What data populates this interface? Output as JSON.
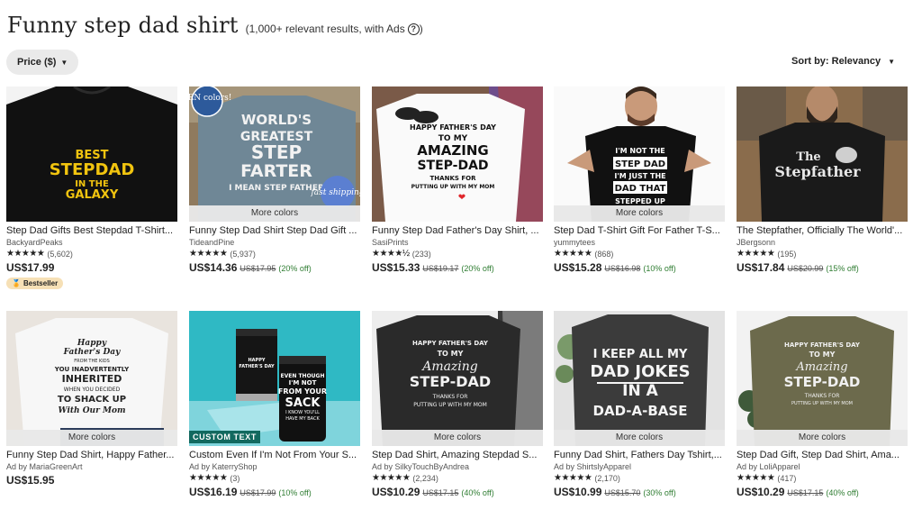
{
  "search": {
    "title": "Funny step dad shirt",
    "results_text": "(1,000+ relevant results, with Ads",
    "help_icon": "?",
    "close_paren": ")"
  },
  "filters": {
    "price_label": "Price ($)",
    "sort_label": "Sort by: Relevancy"
  },
  "products": [
    {
      "title": "Step Dad Gifts Best Stepdad T-Shirt...",
      "shop": "BackyardPeaks",
      "stars": "★★★★★",
      "reviews": "(5,602)",
      "price": "US$17.99",
      "original": "",
      "discount": "",
      "badge": "Bestseller",
      "more_colors": "",
      "image_text": [
        "BEST",
        "STEPDAD",
        "IN THE",
        "GALAXY"
      ]
    },
    {
      "title": "Funny Step Dad Shirt Step Dad Gift ...",
      "shop": "TideandPine",
      "stars": "★★★★★",
      "reviews": "(5,937)",
      "price": "US$14.36",
      "original": "US$17.95",
      "discount": "(20% off)",
      "badge": "",
      "more_colors": "More colors",
      "image_text": [
        "WORLD'S",
        "GREATEST",
        "STEP",
        "FARTER",
        "I MEAN STEP FATHER",
        "TEN colors!",
        "fast shipping"
      ]
    },
    {
      "title": "Funny Step Dad Father's Day Shirt, ...",
      "shop": "SasiPrints",
      "stars": "★★★★½",
      "reviews": "(233)",
      "price": "US$15.33",
      "original": "US$19.17",
      "discount": "(20% off)",
      "badge": "",
      "more_colors": "",
      "image_text": [
        "HAPPY FATHER'S DAY",
        "TO MY",
        "AMAZING",
        "STEP-DAD",
        "THANKS FOR",
        "PUTTING UP WITH MY MOM"
      ]
    },
    {
      "title": "Step Dad T-Shirt Gift For Father T-S...",
      "shop": "yummytees",
      "stars": "★★★★★",
      "reviews": "(868)",
      "price": "US$15.28",
      "original": "US$16.98",
      "discount": "(10% off)",
      "badge": "",
      "more_colors": "More colors",
      "image_text": [
        "I'M NOT THE",
        "STEP DAD",
        "I'M JUST THE",
        "DAD THAT",
        "STEPPED UP"
      ]
    },
    {
      "title": "The Stepfather, Officially The World'...",
      "shop": "JBergsonn",
      "stars": "★★★★★",
      "reviews": "(195)",
      "price": "US$17.84",
      "original": "US$20.99",
      "discount": "(15% off)",
      "badge": "",
      "more_colors": "",
      "image_text": [
        "The",
        "Stepfather"
      ]
    },
    {
      "title": "Funny Step Dad Shirt, Happy Father...",
      "shop": "Ad by MariaGreenArt",
      "stars": "",
      "reviews": "",
      "price": "US$15.95",
      "original": "",
      "discount": "",
      "badge": "",
      "more_colors": "More colors",
      "image_text": [
        "Happy",
        "Father's Day",
        "FROM THE KIDS",
        "YOU INADVERTENTLY",
        "INHERITED",
        "WHEN YOU DECIDED",
        "TO SHACK UP",
        "With Our Mom"
      ]
    },
    {
      "title": "Custom Even If I'm Not From Your S...",
      "shop": "Ad by KaterryShop",
      "stars": "★★★★★",
      "reviews": "(3)",
      "price": "US$16.19",
      "original": "US$17.99",
      "discount": "(10% off)",
      "badge": "",
      "more_colors": "",
      "custom_text": "CUSTOM TEXT",
      "image_text": [
        "HAPPY",
        "FATHER'S DAY",
        "EVEN THOUGH",
        "I'M NOT",
        "FROM YOUR",
        "SACK",
        "I KNOW YOU'LL",
        "HAVE MY BACK"
      ]
    },
    {
      "title": "Step Dad Shirt, Amazing Stepdad S...",
      "shop": "Ad by SilkyTouchByAndrea",
      "stars": "★★★★★",
      "reviews": "(2,234)",
      "price": "US$10.29",
      "original": "US$17.15",
      "discount": "(40% off)",
      "badge": "",
      "more_colors": "More colors",
      "image_text": [
        "HAPPY FATHER'S DAY",
        "TO MY",
        "Amazing",
        "STEP-DAD",
        "THANKS FOR",
        "PUTTING UP WITH MY MOM"
      ]
    },
    {
      "title": "Funny Dad Shirt, Fathers Day Tshirt,...",
      "shop": "Ad by ShirtslyApparel",
      "stars": "★★★★★",
      "reviews": "(2,170)",
      "price": "US$10.99",
      "original": "US$15.70",
      "discount": "(30% off)",
      "badge": "",
      "more_colors": "More colors",
      "image_text": [
        "I KEEP ALL MY",
        "DAD JOKES",
        "IN A",
        "DAD-A-BASE"
      ]
    },
    {
      "title": "Step Dad Gift, Step Dad Shirt, Ama...",
      "shop": "Ad by LoliApparel",
      "stars": "★★★★★",
      "reviews": "(417)",
      "price": "US$10.29",
      "original": "US$17.15",
      "discount": "(40% off)",
      "badge": "",
      "more_colors": "More colors",
      "image_text": [
        "HAPPY FATHER'S DAY",
        "TO MY",
        "Amazing",
        "STEP-DAD",
        "THANKS FOR",
        "PUTTING UP WITH MY MOM"
      ]
    }
  ],
  "colors": {
    "discount_green": "#2f7d32",
    "badge_bg": "#f6e0b6",
    "chip_bg": "#eaeaea",
    "custom_text_bg": "#12695f"
  }
}
